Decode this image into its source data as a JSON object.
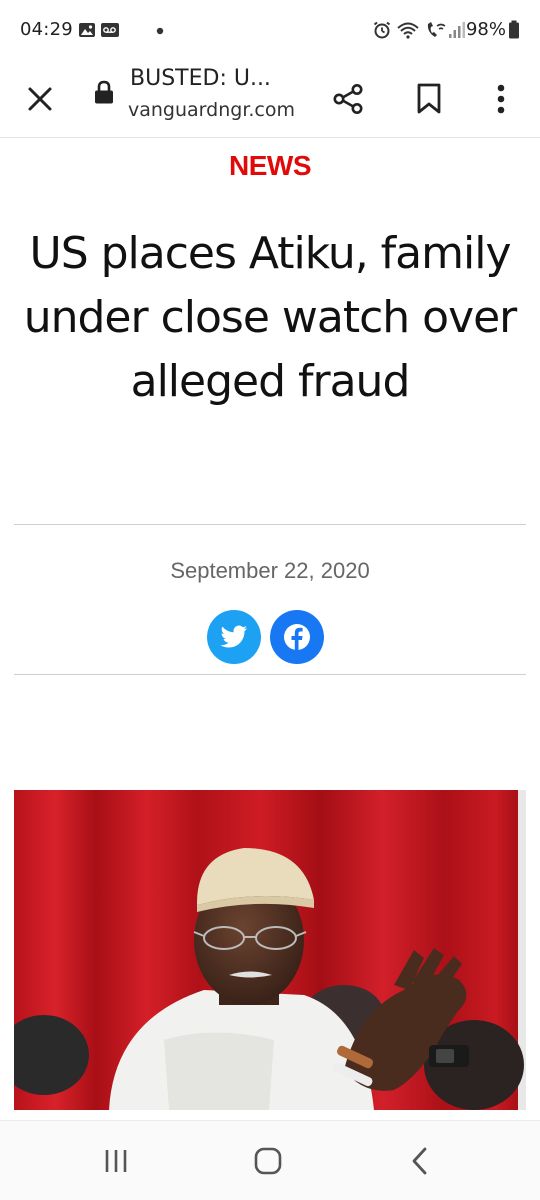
{
  "status_bar": {
    "time": "04:29",
    "battery": "98%",
    "icons_left": [
      "image-icon",
      "voicemail-icon",
      "dot-icon"
    ],
    "icons_right": [
      "alarm-icon",
      "wifi-icon",
      "wifi-call-icon",
      "signal-icon",
      "battery-icon"
    ]
  },
  "toolbar": {
    "title": "BUSTED: U...",
    "url": "vanguardngr.com",
    "close_icon": "close-icon",
    "lock_icon": "lock-icon",
    "share_icon": "share-icon",
    "bookmark_icon": "bookmark-icon",
    "menu_icon": "more-vert-icon"
  },
  "article": {
    "category": "NEWS",
    "headline": "US places Atiku, family under close watch over alleged fraud",
    "date": "September 22, 2020",
    "share_buttons": [
      {
        "name": "twitter",
        "icon": "twitter-icon",
        "color": "#1da1f2"
      },
      {
        "name": "facebook",
        "icon": "facebook-icon",
        "color": "#1877f2"
      }
    ],
    "photo_alt": "Atiku Abubakar"
  },
  "colors": {
    "category": "#e00a0a",
    "curtain": "#c8161c",
    "twitter": "#1da1f2",
    "facebook": "#1877f2"
  },
  "navbar": {
    "icons": [
      "recents-icon",
      "home-icon",
      "back-icon"
    ]
  }
}
